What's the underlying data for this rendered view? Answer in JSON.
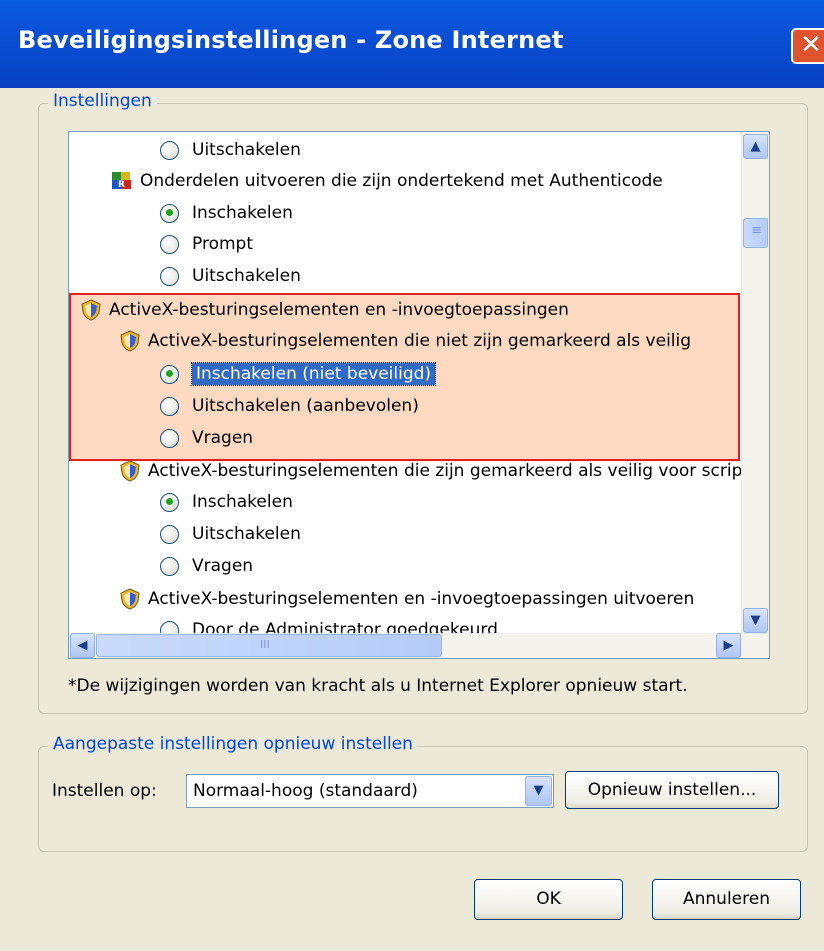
{
  "window": {
    "title": "Beveiligingsinstellingen - Zone Internet",
    "close_glyph": "✕"
  },
  "settings_group": {
    "legend": "Instellingen"
  },
  "tree": {
    "rows": [
      {
        "label": "Uitschakelen",
        "kind": "radio",
        "checked": false
      },
      {
        "label": "Onderdelen uitvoeren die zijn ondertekend met Authenticode",
        "kind": "category",
        "icon": "activex-component-icon"
      },
      {
        "label": "Inschakelen",
        "kind": "radio",
        "checked": true
      },
      {
        "label": "Prompt",
        "kind": "radio",
        "checked": false
      },
      {
        "label": "Uitschakelen",
        "kind": "radio",
        "checked": false
      },
      {
        "label": "ActiveX-besturingselementen en -invoegtoepassingen",
        "kind": "category",
        "icon": "shield-icon"
      },
      {
        "label": "ActiveX-besturingselementen die niet zijn gemarkeerd als veilig",
        "kind": "category",
        "icon": "shield-icon"
      },
      {
        "label": "Inschakelen (niet beveiligd)",
        "kind": "radio",
        "checked": true,
        "selected": true
      },
      {
        "label": "Uitschakelen (aanbevolen)",
        "kind": "radio",
        "checked": false
      },
      {
        "label": "Vragen",
        "kind": "radio",
        "checked": false
      },
      {
        "label": "ActiveX-besturingselementen die zijn gemarkeerd als veilig voor scripting",
        "kind": "category",
        "icon": "shield-icon"
      },
      {
        "label": "Inschakelen",
        "kind": "radio",
        "checked": true
      },
      {
        "label": "Uitschakelen",
        "kind": "radio",
        "checked": false
      },
      {
        "label": "Vragen",
        "kind": "radio",
        "checked": false
      },
      {
        "label": "ActiveX-besturingselementen en -invoegtoepassingen uitvoeren",
        "kind": "category",
        "icon": "shield-icon"
      },
      {
        "label": "Door de Administrator goedgekeurd",
        "kind": "radio",
        "checked": false
      }
    ]
  },
  "scroll": {
    "up": "▲",
    "down": "▼",
    "left": "◀",
    "right": "▶",
    "grip": "≡",
    "hgrip": "III"
  },
  "restart_note": "*De wijzigingen worden van kracht als u Internet Explorer opnieuw start.",
  "reset_group": {
    "legend": "Aangepaste instellingen opnieuw instellen",
    "reset_label": "Instellen op:",
    "reset_value": "Normaal-hoog (standaard)",
    "dropdown_glyph": "▼",
    "reset_button": "Opnieuw instellen..."
  },
  "buttons": {
    "ok": "OK",
    "cancel": "Annuleren"
  },
  "colors": {
    "titlebar": "#0A4FD6",
    "highlight": "#316AC5",
    "annotation_fill": "#FCD9C0",
    "annotation_border": "#E0211E"
  }
}
